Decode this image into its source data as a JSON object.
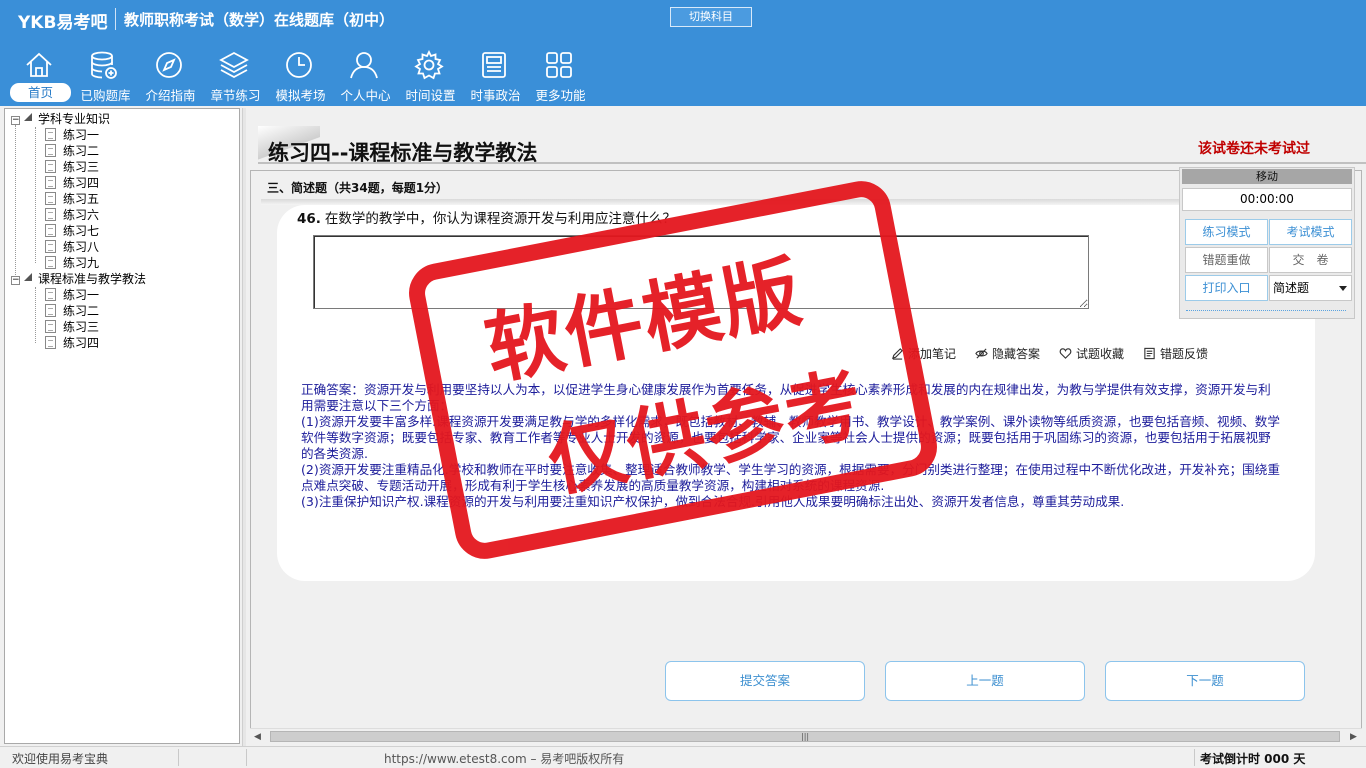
{
  "header": {
    "logo": "YKB易考吧",
    "title": "教师职称考试（数学）在线题库（初中）",
    "switch_subject": "切换科目",
    "nav": [
      {
        "label": "首页",
        "icon": "home-icon",
        "active": true
      },
      {
        "label": "已购题库",
        "icon": "database-icon"
      },
      {
        "label": "介绍指南",
        "icon": "compass-icon"
      },
      {
        "label": "章节练习",
        "icon": "layers-icon"
      },
      {
        "label": "模拟考场",
        "icon": "clock-icon"
      },
      {
        "label": "个人中心",
        "icon": "user-icon"
      },
      {
        "label": "时间设置",
        "icon": "gear-icon"
      },
      {
        "label": "时事政治",
        "icon": "newspaper-icon"
      },
      {
        "label": "更多功能",
        "icon": "grid-icon"
      }
    ]
  },
  "tree": {
    "groups": [
      {
        "label": "学科专业知识",
        "items": [
          "练习一",
          "练习二",
          "练习三",
          "练习四",
          "练习五",
          "练习六",
          "练习七",
          "练习八",
          "练习九"
        ]
      },
      {
        "label": "课程标准与教学教法",
        "items": [
          "练习一",
          "练习二",
          "练习三",
          "练习四"
        ]
      }
    ]
  },
  "main": {
    "paper_title": "练习四--课程标准与教学教法",
    "exam_status": "该试卷还未考试过",
    "section_header": "三、简述题（共34题，每题1分）",
    "question": {
      "number": "46.",
      "text": "在数学的教学中，你认为课程资源开发与利用应注意什么？"
    },
    "tools": {
      "add_note": "添加笔记",
      "hide_answer": "隐藏答案",
      "favorite": "试题收藏",
      "report_error": "错题反馈"
    },
    "correct_answer": [
      "正确答案：资源开发与利用要坚持以人为本，以促进学生身心健康发展作为首要任务，从促进学生核心素养形成和发展的内在规律出发，为教与学提供有效支撑，资源开发与利用需要注意以下三个方面：",
      "(1)资源开发要丰富多样.课程资源开发要满足教与学的多样化需求，既包括教材、教辅、教师教学用书、教学设计、教学案例、课外读物等纸质资源，也要包括音频、视频、数学软件等数字资源；既要包括专家、教育工作者等专业人士开发的资源，也要包括科学家、企业家等社会人士提供的资源；既要包括用于巩固练习的资源，也要包括用于拓展视野的各类资源.",
      "(2)资源开发要注重精品化.学校和教师在平时要注意收集、整理适合教师教学、学生学习的资源，根据需要，分门别类进行整理；在使用过程中不断优化改进，开发补充；围绕重点难点突破、专题活动开展，形成有利于学生核心素养发展的高质量教学资源，构建相对系统的课程资源.",
      "(3)注重保护知识产权.课程资源的开发与利用要注重知识产权保护，做到合法合规.引用他人成果要明确标注出处、资源开发者信息，尊重其劳动成果."
    ],
    "buttons": {
      "submit": "提交答案",
      "prev": "上一题",
      "next": "下一题"
    }
  },
  "control_panel": {
    "move": "移动",
    "timer": "00:00:00",
    "practice_mode": "练习模式",
    "exam_mode": "考试模式",
    "redo_wrong": "错题重做",
    "hand_in": "交　卷",
    "print": "打印入口",
    "question_type": "简述题"
  },
  "watermark": {
    "line1": "软件模版",
    "line2": "仅供参考"
  },
  "statusbar": {
    "welcome": "欢迎使用易考宝典",
    "copyright": "https://www.etest8.com – 易考吧版权所有",
    "countdown": "考试倒计时 000 天"
  },
  "colors": {
    "header_bg": "#3a8fd8",
    "status_red": "#c00000",
    "answer_blue": "#1c1c9a",
    "stamp_red": "#e4171e"
  }
}
